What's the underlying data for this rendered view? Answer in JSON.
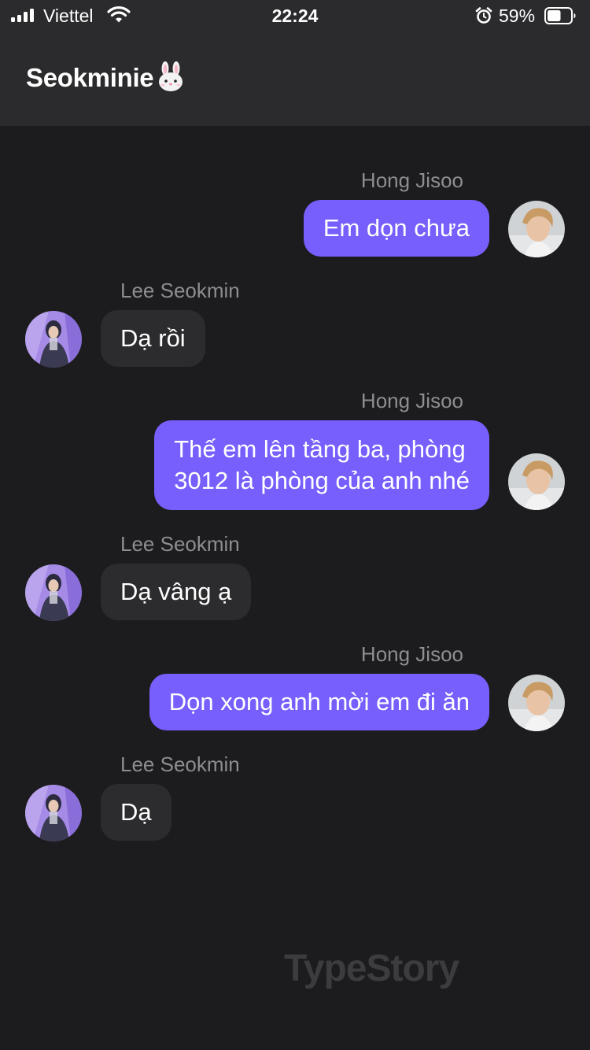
{
  "status_bar": {
    "carrier": "Viettel",
    "time": "22:24",
    "battery_percent": "59%",
    "battery_level": 0.59,
    "signal_bars": 4,
    "icons": [
      "signal-icon",
      "wifi-icon",
      "alarm-icon",
      "battery-icon"
    ]
  },
  "header": {
    "title": "Seokminie",
    "title_emoji": "bunny-icon"
  },
  "messages": [
    {
      "sender": "Hong Jisoo",
      "side": "right",
      "text": "Em dọn chưa"
    },
    {
      "sender": "Lee Seokmin",
      "side": "left",
      "text": "Dạ rồi"
    },
    {
      "sender": "Hong Jisoo",
      "side": "right",
      "text_lines": [
        "Thế em lên tầng ba, phòng",
        "3012 là phòng của anh nhé"
      ]
    },
    {
      "sender": "Lee Seokmin",
      "side": "left",
      "text": "Dạ vâng ạ"
    },
    {
      "sender": "Hong Jisoo",
      "side": "right",
      "text": "Dọn xong anh mời em đi ăn"
    },
    {
      "sender": "Lee Seokmin",
      "side": "left",
      "text": "Dạ"
    }
  ],
  "watermark": "TypeStory",
  "colors": {
    "outgoing_bubble": "#765ffc",
    "incoming_bubble": "#2c2c2e",
    "background": "#1c1c1e",
    "header": "#2b2b2d",
    "sender_name": "#8d8d92"
  }
}
